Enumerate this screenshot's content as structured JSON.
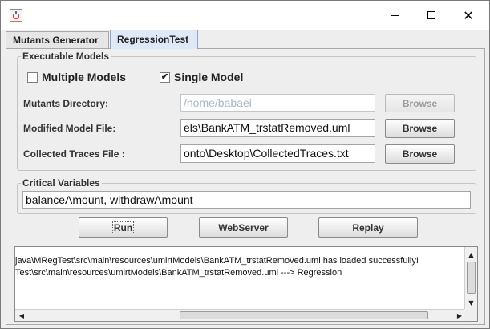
{
  "window": {
    "title": "",
    "controls": {
      "minimize": "—",
      "maximize": "□",
      "close": "✕"
    },
    "app_icon": "java-cup-icon"
  },
  "tabs": [
    {
      "label": "Mutants Generator",
      "selected": false
    },
    {
      "label": "RegressionTest",
      "selected": true
    }
  ],
  "executable_models": {
    "legend": "Executable Models",
    "multiple_models": {
      "label": "Multiple Models",
      "checked": false,
      "mark": ""
    },
    "single_model": {
      "label": "Single Model",
      "checked": true,
      "mark": "✔"
    },
    "mutants_directory": {
      "label": "Mutants  Directory:",
      "value": "/home/babaei",
      "enabled": false,
      "browse_label": "Browse"
    },
    "modified_model_file": {
      "label": "Modified Model  File:",
      "value": "els\\BankATM_trstatRemoved.uml",
      "browse_label": "Browse"
    },
    "collected_traces_file": {
      "label": "Collected Traces File :",
      "value": "onto\\Desktop\\CollectedTraces.txt",
      "browse_label": "Browse"
    }
  },
  "critical_variables": {
    "legend": "Critical Variables",
    "value": "balanceAmount, withdrawAmount"
  },
  "actions": {
    "run_label": "Run",
    "webserver_label": "WebServer",
    "replay_label": "Replay"
  },
  "log": {
    "lines": [
      "java\\MRegTest\\src\\main\\resources\\umlrtModels\\BankATM_trstatRemoved.uml has loaded successfully!",
      "Test\\src\\main\\resources\\umlrtModels\\BankATM_trstatRemoved.uml ---> Regression"
    ],
    "scroll_up": "▲",
    "scroll_down": "▼",
    "scroll_left": "◀",
    "scroll_right": "▶"
  }
}
